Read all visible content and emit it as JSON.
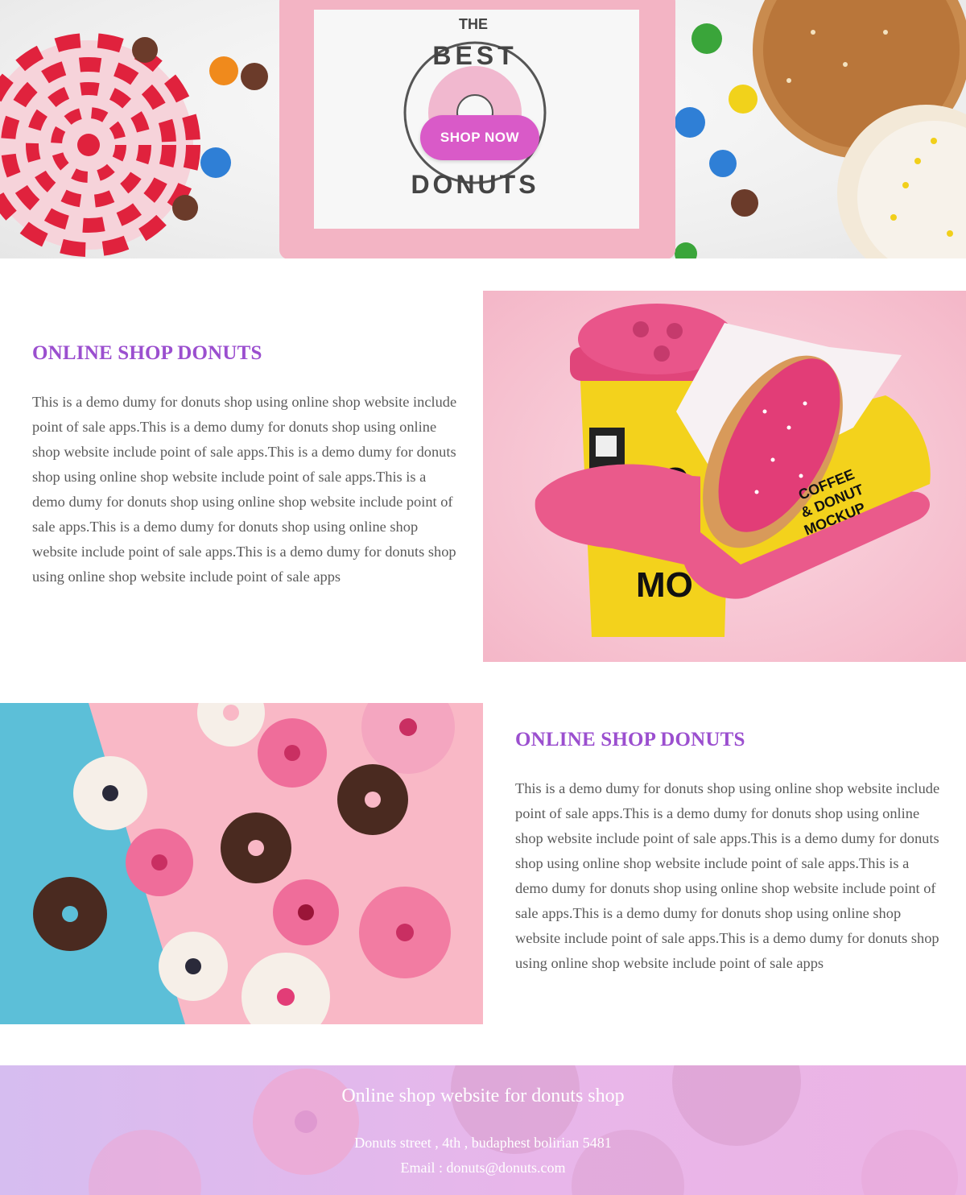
{
  "hero": {
    "sign_top": "THE",
    "sign_best": "BEST",
    "sign_donuts": "DONUTS",
    "shop_button_label": "SHOP NOW",
    "colors": {
      "button": "#d95ac8",
      "frame": "#f3b4c4"
    }
  },
  "section1": {
    "heading": "ONLINE SHOP DONUTS",
    "body": "This is a demo dumy for donuts shop using online shop website include point of sale apps.This is a demo dumy for donuts shop using online shop website include point of sale apps.This is a demo dumy for donuts shop using online shop website include point of sale apps.This is a demo dumy for donuts shop using online shop website include point of sale apps.This is a demo dumy for donuts shop using online shop website include point of sale apps.This is a demo dumy for donuts shop using online shop website include point of sale apps",
    "mockup_box_text": [
      "COFFEE",
      "& DONUT",
      "MOCKUP"
    ],
    "mockup_cup_text": [
      "CO",
      "MO"
    ]
  },
  "section2": {
    "heading": "ONLINE SHOP DONUTS",
    "body": "This is a demo dumy for donuts shop using online shop website include point of sale apps.This is a demo dumy for donuts shop using online shop website include point of sale apps.This is a demo dumy for donuts shop using online shop website include point of sale apps.This is a demo dumy for donuts shop using online shop website include point of sale apps.This is a demo dumy for donuts shop using online shop website include point of sale apps.This is a demo dumy for donuts shop using online shop website include point of sale apps"
  },
  "footer": {
    "title": "Online shop website for donuts shop",
    "address": "Donuts street , 4th , budaphest bolirian 5481",
    "email": "Email : donuts@donuts.com"
  },
  "theme": {
    "heading_color": "#9b4fcf",
    "body_text_color": "#5a5a5a"
  }
}
